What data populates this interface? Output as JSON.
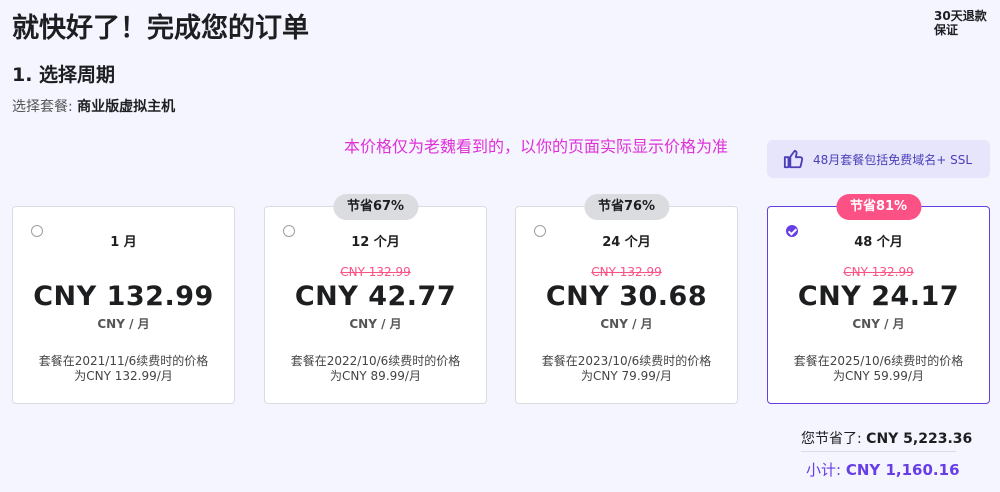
{
  "header": {
    "title": "就快好了！完成您的订单",
    "guarantee_line1": "30天退款",
    "guarantee_line2": "保证"
  },
  "section": {
    "title": "1. 选择周期",
    "plan_label": "选择套餐:",
    "plan_value": "商业版虚拟主机"
  },
  "note": "本价格仅为老魏看到的，以你的页面实际显示价格为准",
  "promo": {
    "icon": "thumbs-up-icon",
    "text": "48月套餐包括免费域名+ SSL"
  },
  "cards": [
    {
      "badge": "",
      "period": "1 月",
      "old_price": "",
      "price": "CNY 132.99",
      "unit": "CNY / 月",
      "renew_line1": "套餐在2021/11/6续费时的价格",
      "renew_line2": "为CNY 132.99/月",
      "selected": false
    },
    {
      "badge": "节省67%",
      "period": "12 个月",
      "old_price": "CNY 132.99",
      "price": "CNY 42.77",
      "unit": "CNY / 月",
      "renew_line1": "套餐在2022/10/6续费时的价格",
      "renew_line2": "为CNY 89.99/月",
      "selected": false
    },
    {
      "badge": "节省76%",
      "period": "24 个月",
      "old_price": "CNY 132.99",
      "price": "CNY 30.68",
      "unit": "CNY / 月",
      "renew_line1": "套餐在2023/10/6续费时的价格",
      "renew_line2": "为CNY 79.99/月",
      "selected": false
    },
    {
      "badge": "节省81%",
      "period": "48 个月",
      "old_price": "CNY 132.99",
      "price": "CNY 24.17",
      "unit": "CNY / 月",
      "renew_line1": "套餐在2025/10/6续费时的价格",
      "renew_line2": "为CNY 59.99/月",
      "selected": true
    }
  ],
  "summary": {
    "savings_label": "您节省了:",
    "savings_value": "CNY 5,223.36",
    "subtotal_label": "小计:",
    "subtotal_value": "CNY 1,160.16"
  },
  "colors": {
    "accent": "#673de6",
    "hot_badge": "#fc5185",
    "note": "#e030d8"
  }
}
